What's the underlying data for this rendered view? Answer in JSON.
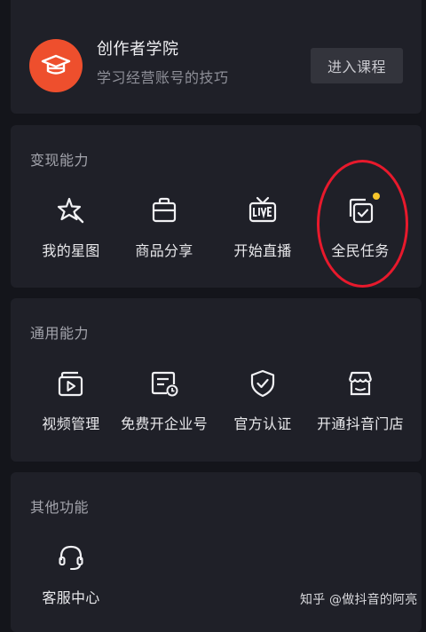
{
  "academy": {
    "title": "创作者学院",
    "subtitle": "学习经营账号的技巧",
    "button_label": "进入课程",
    "logo_icon": "graduation-cap-icon",
    "logo_color": "#ee4f2d"
  },
  "monetization": {
    "title": "变现能力",
    "items": [
      {
        "label": "我的星图",
        "icon": "sparkle-star-icon"
      },
      {
        "label": "商品分享",
        "icon": "shopping-bag-icon"
      },
      {
        "label": "开始直播",
        "icon": "live-tv-icon"
      },
      {
        "label": "全民任务",
        "icon": "task-stack-icon",
        "badge_color": "#f7c52b"
      }
    ]
  },
  "general": {
    "title": "通用能力",
    "items": [
      {
        "label": "视频管理",
        "icon": "video-file-icon"
      },
      {
        "label": "免费开企业号",
        "icon": "enterprise-clock-icon"
      },
      {
        "label": "官方认证",
        "icon": "shield-check-icon"
      },
      {
        "label": "开通抖音门店",
        "icon": "storefront-icon"
      }
    ]
  },
  "other": {
    "title": "其他功能",
    "items": [
      {
        "label": "客服中心",
        "icon": "headset-icon"
      }
    ]
  },
  "watermark": "知乎 @做抖音的阿亮",
  "colors": {
    "background": "#14151b",
    "card": "#1f2028",
    "annotation_circle": "#e8192c"
  }
}
